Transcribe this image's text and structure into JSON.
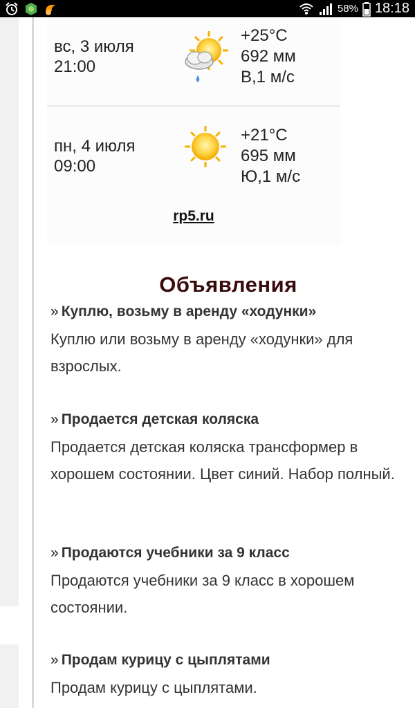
{
  "status_bar": {
    "battery_percent": "58%",
    "time": "18:18",
    "left_icons": [
      "alarm-icon",
      "app-green-icon",
      "app-orange-icon"
    ],
    "right_icons": [
      "wifi-icon",
      "signal-icon",
      "battery-icon"
    ]
  },
  "weather": {
    "rows": [
      {
        "date": "вс, 3 июля",
        "time": "21:00",
        "icon": "partly-cloudy-rain-icon",
        "temp": "+25°C",
        "pressure": "692 мм",
        "wind": "В,1 м/с"
      },
      {
        "date": "пн, 4 июля",
        "time": "09:00",
        "icon": "sun-icon",
        "temp": "+21°C",
        "pressure": "695 мм",
        "wind": "Ю,1 м/с"
      }
    ],
    "source": "rp5.ru"
  },
  "ads": {
    "title": "Объявления",
    "bullet": "»",
    "items": [
      {
        "title": "Куплю, возьму в аренду «ходунки»",
        "body": "Куплю или возьму в аренду «ходунки» для взрослых."
      },
      {
        "title": "Продается детская коляска",
        "body": "Продается детская коляска трансформер в хорошем состоянии. Цвет синий. Набор полный."
      },
      {
        "title": "Продаются учебники за 9 класс",
        "body": "Продаются учебники за 9 класс в хорошем состоянии."
      },
      {
        "title": "Продам курицу с цыплятами",
        "body": "Продам курицу с цыплятами."
      }
    ]
  },
  "colors": {
    "ads_title": "#3a0b0b",
    "sun": "#ffcc33",
    "status_bar_bg": "#000000"
  }
}
